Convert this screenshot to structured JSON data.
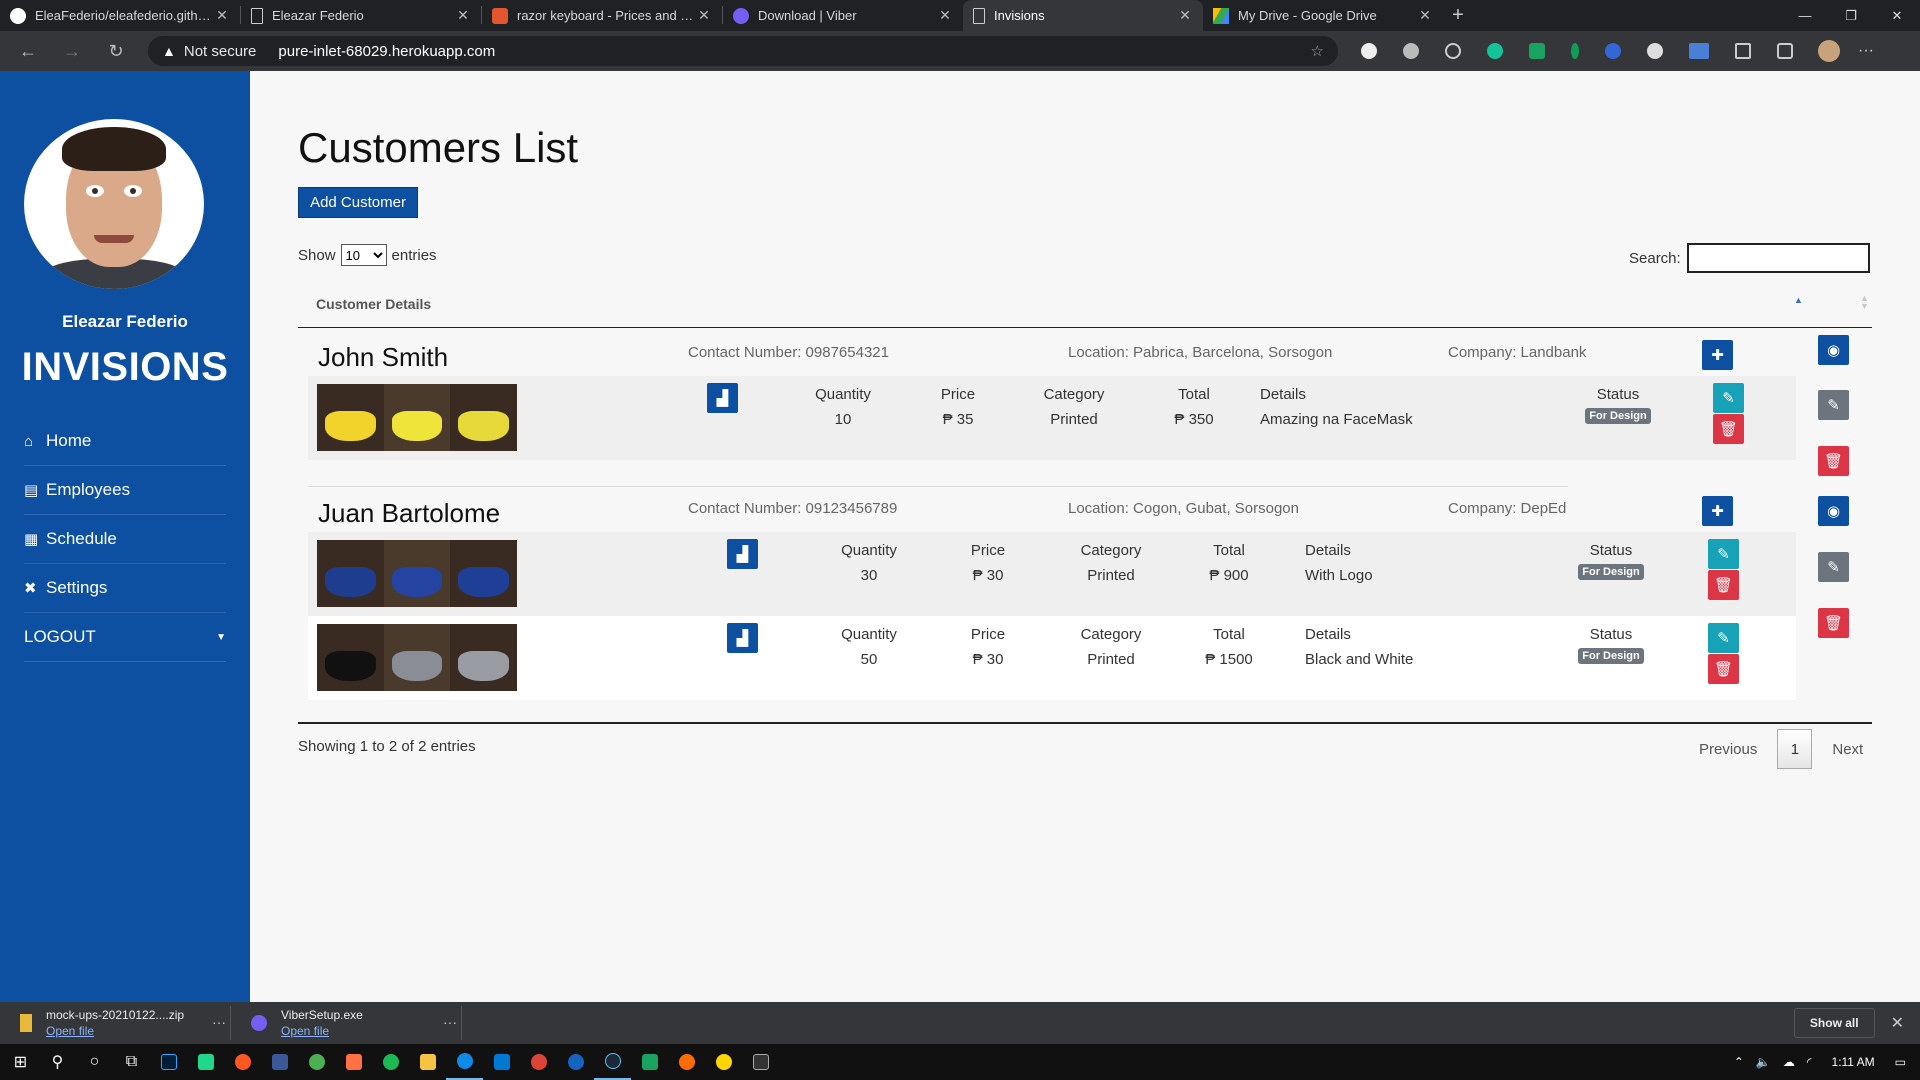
{
  "browser": {
    "tabs": [
      {
        "title": "EleaFederio/eleafederio.github.io",
        "icon": "github-icon",
        "color": "#ffffff",
        "active": false
      },
      {
        "title": "Eleazar Federio",
        "icon": "page-icon",
        "color": "#cccccc",
        "active": false
      },
      {
        "title": "razor keyboard - Prices and Online",
        "icon": "shop-icon",
        "color": "#e4572e",
        "active": false
      },
      {
        "title": "Download | Viber",
        "icon": "viber-icon",
        "color": "#7360f2",
        "active": false
      },
      {
        "title": "Invisions",
        "icon": "page-icon",
        "color": "#cccccc",
        "active": true
      },
      {
        "title": "My Drive - Google Drive",
        "icon": "drive-icon",
        "color": "#34a853",
        "active": false
      }
    ],
    "security_label": "Not secure",
    "url": "pure-inlet-68029.herokuapp.com"
  },
  "sidebar": {
    "user_name": "Eleazar Federio",
    "brand": "INVISIONS",
    "accent": "#0d4fa0",
    "nav": [
      {
        "label": "Home",
        "icon": "home-icon"
      },
      {
        "label": "Employees",
        "icon": "id-card-icon"
      },
      {
        "label": "Schedule",
        "icon": "calendar-icon"
      },
      {
        "label": "Settings",
        "icon": "tools-icon"
      },
      {
        "label": "LOGOUT",
        "icon": "caret-down-icon"
      }
    ]
  },
  "main": {
    "title": "Customers List",
    "add_button": "Add Customer",
    "show_label": "Show",
    "entries_label": "entries",
    "page_size": "10",
    "search_label": "Search:",
    "column_header": "Customer Details",
    "customers": [
      {
        "name": "John Smith",
        "contact": "Contact Number: 0987654321",
        "location": "Location: Pabrica, Barcelona, Sorsogon",
        "company": "Company: Landbank",
        "orders": [
          {
            "quantity_label": "Quantity",
            "quantity": "10",
            "price_label": "Price",
            "price": "₱ 35",
            "category_label": "Category",
            "category": "Printed",
            "total_label": "Total",
            "total": "₱ 350",
            "details_label": "Details",
            "details": "Amazing na FaceMask",
            "status_label": "Status",
            "status": "For Design"
          }
        ]
      },
      {
        "name": "Juan Bartolome",
        "contact": "Contact Number: 09123456789",
        "location": "Location: Cogon, Gubat, Sorsogon",
        "company": "Company: DepEd",
        "orders": [
          {
            "quantity_label": "Quantity",
            "quantity": "30",
            "price_label": "Price",
            "price": "₱ 30",
            "category_label": "Category",
            "category": "Printed",
            "total_label": "Total",
            "total": "₱ 900",
            "details_label": "Details",
            "details": "With Logo",
            "status_label": "Status",
            "status": "For Design"
          },
          {
            "quantity_label": "Quantity",
            "quantity": "50",
            "price_label": "Price",
            "price": "₱ 30",
            "category_label": "Category",
            "category": "Printed",
            "total_label": "Total",
            "total": "₱ 1500",
            "details_label": "Details",
            "details": "Black and White",
            "status_label": "Status",
            "status": "For Design"
          }
        ]
      }
    ],
    "showing": "Showing 1 to 2 of 2 entries",
    "pager": {
      "previous": "Previous",
      "current": "1",
      "next": "Next"
    }
  },
  "downloads": [
    {
      "name": "mock-ups-20210122....zip",
      "action": "Open file"
    },
    {
      "name": "ViberSetup.exe",
      "action": "Open file"
    }
  ],
  "downloads_show_all": "Show all",
  "taskbar": {
    "time": "1:11 AM"
  }
}
